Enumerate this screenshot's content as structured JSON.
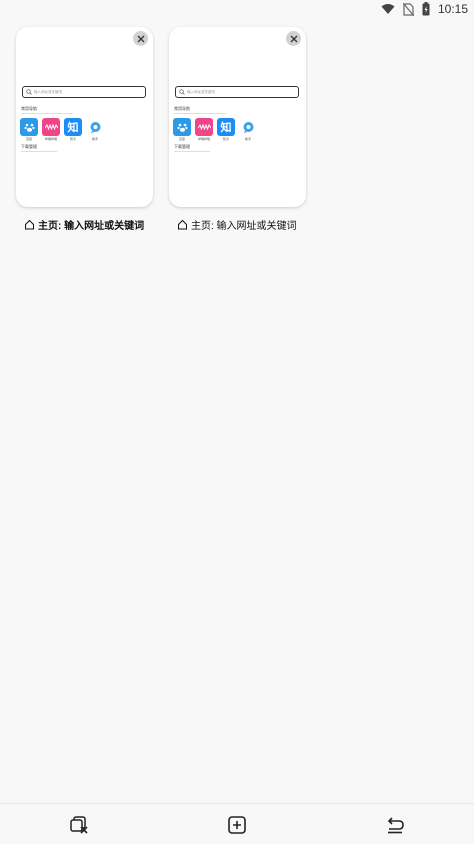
{
  "status_bar": {
    "time": "10:15",
    "icons": [
      "wifi-icon",
      "no-sim-icon",
      "battery-icon"
    ]
  },
  "tabs": [
    {
      "label": "主页: 输入网址或关键词",
      "search_placeholder": "输入网址或关键词",
      "section1": "常用导航",
      "apps": [
        {
          "icon": "paw-icon",
          "label": "百度"
        },
        {
          "icon": "wave-icon",
          "label": "哔哩哔哩"
        },
        {
          "icon": "zhi-icon",
          "text": "知",
          "label": "知乎"
        },
        {
          "icon": "chat-bubble-icon",
          "label": "助手"
        }
      ],
      "section2": "下载管理"
    },
    {
      "label": "主页: 输入网址或关键词",
      "search_placeholder": "输入网址或关键词",
      "section1": "常用导航",
      "apps": [
        {
          "icon": "paw-icon",
          "label": "百度"
        },
        {
          "icon": "wave-icon",
          "label": "哔哩哔哩"
        },
        {
          "icon": "zhi-icon",
          "text": "知",
          "label": "知乎"
        },
        {
          "icon": "chat-bubble-icon",
          "label": "助手"
        }
      ],
      "section2": "下载管理"
    }
  ],
  "bottom_bar": {
    "buttons": [
      "close-all-tabs-icon",
      "new-tab-icon",
      "back-icon"
    ]
  },
  "colors": {
    "background": "#f8f8f8",
    "paw": "#2d9ae8",
    "wave": "#f0458b",
    "zhi": "#1d8cf5"
  }
}
